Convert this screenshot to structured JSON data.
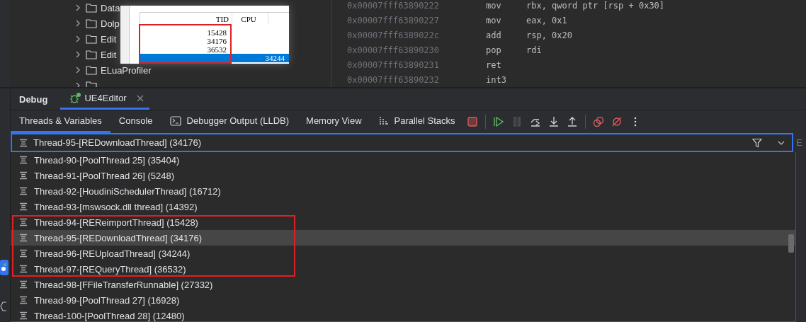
{
  "project_tree": {
    "items": [
      {
        "label": "Data",
        "expanded": false
      },
      {
        "label": "Dolp",
        "expanded": false
      },
      {
        "label": "Edit",
        "expanded": false
      },
      {
        "label": "Edit",
        "expanded": false
      },
      {
        "label": "ELuaProfiler",
        "expanded": false
      },
      {
        "expanded": false
      }
    ]
  },
  "overlay_screenshot": {
    "columns": [
      "TID",
      "CPU"
    ],
    "rows": [
      {
        "tid": "15428",
        "selected": false
      },
      {
        "tid": "34176",
        "selected": false
      },
      {
        "tid": "36532",
        "selected": false
      },
      {
        "tid": "34244",
        "selected": true
      }
    ]
  },
  "disassembly": [
    {
      "address": "0x00007fff63890222",
      "mnemonic": "mov",
      "operands": "rbx, qword ptr [rsp + 0x30]"
    },
    {
      "address": "0x00007fff63890227",
      "mnemonic": "mov",
      "operands": "eax, 0x1"
    },
    {
      "address": "0x00007fff6389022c",
      "mnemonic": "add",
      "operands": "rsp, 0x20"
    },
    {
      "address": "0x00007fff63890230",
      "mnemonic": "pop",
      "operands": "rdi"
    },
    {
      "address": "0x00007fff63890231",
      "mnemonic": "ret"
    },
    {
      "address": "0x00007fff63890232",
      "mnemonic": "int3"
    }
  ],
  "debug_panel": {
    "title": "Debug",
    "sessions": [
      {
        "label": "UE4Editor",
        "selected": true
      }
    ],
    "tabs": [
      {
        "label": "Threads & Variables",
        "selected": true,
        "kind": "plain"
      },
      {
        "label": "Console",
        "selected": false,
        "kind": "plain"
      },
      {
        "label": "Debugger Output (LLDB)",
        "selected": false,
        "kind": "terminal"
      },
      {
        "label": "Memory View",
        "selected": false,
        "kind": "plain"
      },
      {
        "label": "Parallel Stacks",
        "selected": false,
        "kind": "stacks"
      }
    ],
    "toolbar": [
      {
        "kind": "stop",
        "disabled": false
      },
      {
        "kind": "separator"
      },
      {
        "kind": "resume",
        "disabled": false
      },
      {
        "kind": "pause",
        "disabled": true
      },
      {
        "kind": "step-over",
        "disabled": false
      },
      {
        "kind": "step-into",
        "disabled": false
      },
      {
        "kind": "step-out",
        "disabled": false
      },
      {
        "kind": "separator"
      },
      {
        "kind": "breakpoints",
        "disabled": false
      },
      {
        "kind": "mute",
        "disabled": false
      },
      {
        "kind": "more",
        "disabled": false
      }
    ]
  },
  "thread_selector": {
    "value": "Thread-95-[REDownloadThread] (34176)"
  },
  "side_label": "E",
  "threads": [
    {
      "label": "Thread-90-[PoolThread 25] (35404)",
      "selected": false,
      "marked": false
    },
    {
      "label": "Thread-91-[PoolThread 26] (5248)",
      "selected": false,
      "marked": false
    },
    {
      "label": "Thread-92-[HoudiniSchedulerThread] (16712)",
      "selected": false,
      "marked": false
    },
    {
      "label": "Thread-93-[mswsock.dll thread] (14392)",
      "selected": false,
      "marked": false
    },
    {
      "label": "Thread-94-[REReimportThread] (15428)",
      "selected": false,
      "marked": true
    },
    {
      "label": "Thread-95-[REDownloadThread] (34176)",
      "selected": true,
      "marked": true
    },
    {
      "label": "Thread-96-[REUploadThread] (34244)",
      "selected": false,
      "marked": true
    },
    {
      "label": "Thread-97-[REQueryThread] (36532)",
      "selected": false,
      "marked": true
    },
    {
      "label": "Thread-98-[FFileTransferRunnable] (27332)",
      "selected": false,
      "marked": false
    },
    {
      "label": "Thread-99-[PoolThread 27] (16928)",
      "selected": false,
      "marked": false
    },
    {
      "label": "Thread-100-[PoolThread 28] (12480)",
      "selected": false,
      "marked": false
    }
  ]
}
